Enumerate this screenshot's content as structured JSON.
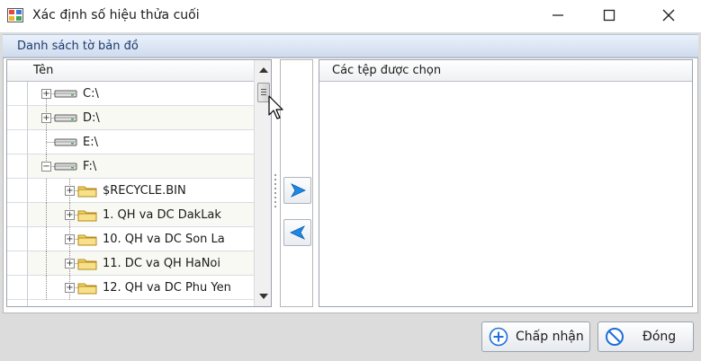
{
  "window": {
    "title": "Xác định số hiệu thửa cuối"
  },
  "group": {
    "label": "Danh sách tờ bản đồ"
  },
  "tree": {
    "column_header": "Tên",
    "items": [
      {
        "label": "C:\\",
        "type": "drive",
        "expander": "+",
        "alt": false
      },
      {
        "label": "D:\\",
        "type": "drive",
        "expander": "+",
        "alt": true
      },
      {
        "label": "E:\\",
        "type": "drive",
        "expander": "",
        "alt": false
      },
      {
        "label": "F:\\",
        "type": "drive",
        "expander": "−",
        "alt": true
      },
      {
        "label": "$RECYCLE.BIN",
        "type": "folder",
        "expander": "+",
        "alt": false
      },
      {
        "label": "1. QH va DC DakLak",
        "type": "folder",
        "expander": "+",
        "alt": true
      },
      {
        "label": "10. QH va DC Son La",
        "type": "folder",
        "expander": "+",
        "alt": false
      },
      {
        "label": "11. DC va QH HaNoi",
        "type": "folder",
        "expander": "+",
        "alt": true
      },
      {
        "label": "12. QH va DC Phu Yen",
        "type": "folder",
        "expander": "+",
        "alt": false
      }
    ]
  },
  "selected": {
    "column_header": "Các tệp được chọn"
  },
  "buttons": {
    "accept_label": "Chấp nhận",
    "close_label": "Đóng"
  },
  "colors": {
    "folder": "#f5d563",
    "arrow_blue": "#1e88e5",
    "header_text": "#1e3a6e"
  }
}
